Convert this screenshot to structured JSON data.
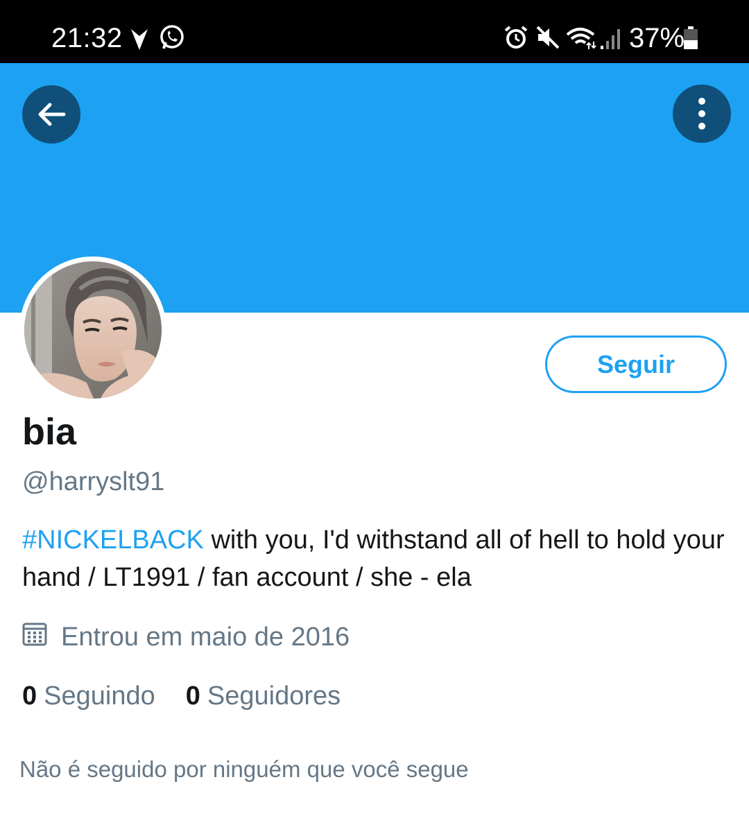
{
  "status_bar": {
    "time": "21:32",
    "battery_percent": "37%",
    "icons": [
      "vpn-arrow-icon",
      "whatsapp-icon",
      "alarm-icon",
      "mute-icon",
      "wifi-icon",
      "signal-icon",
      "battery-icon"
    ]
  },
  "header": {
    "banner_color": "#1da1f2",
    "back_icon": "arrow-left-icon",
    "more_icon": "more-vertical-icon"
  },
  "profile": {
    "avatar": "profile-photo",
    "follow_label": "Seguir",
    "display_name": "bia",
    "handle": "@harryslt91",
    "bio_hashtag": "#NICKELBACK",
    "bio_text": " with you, I'd withstand all of hell to hold your hand / LT1991 / fan account / she - ela",
    "joined": "Entrou em maio de 2016",
    "following_count": "0",
    "following_label": "Seguindo",
    "followers_count": "0",
    "followers_label": "Seguidores",
    "mutual_note": "Não é seguido por ninguém que você segue"
  },
  "colors": {
    "accent": "#1da1f2",
    "secondary_text": "#657786",
    "primary_text": "#14171a"
  }
}
